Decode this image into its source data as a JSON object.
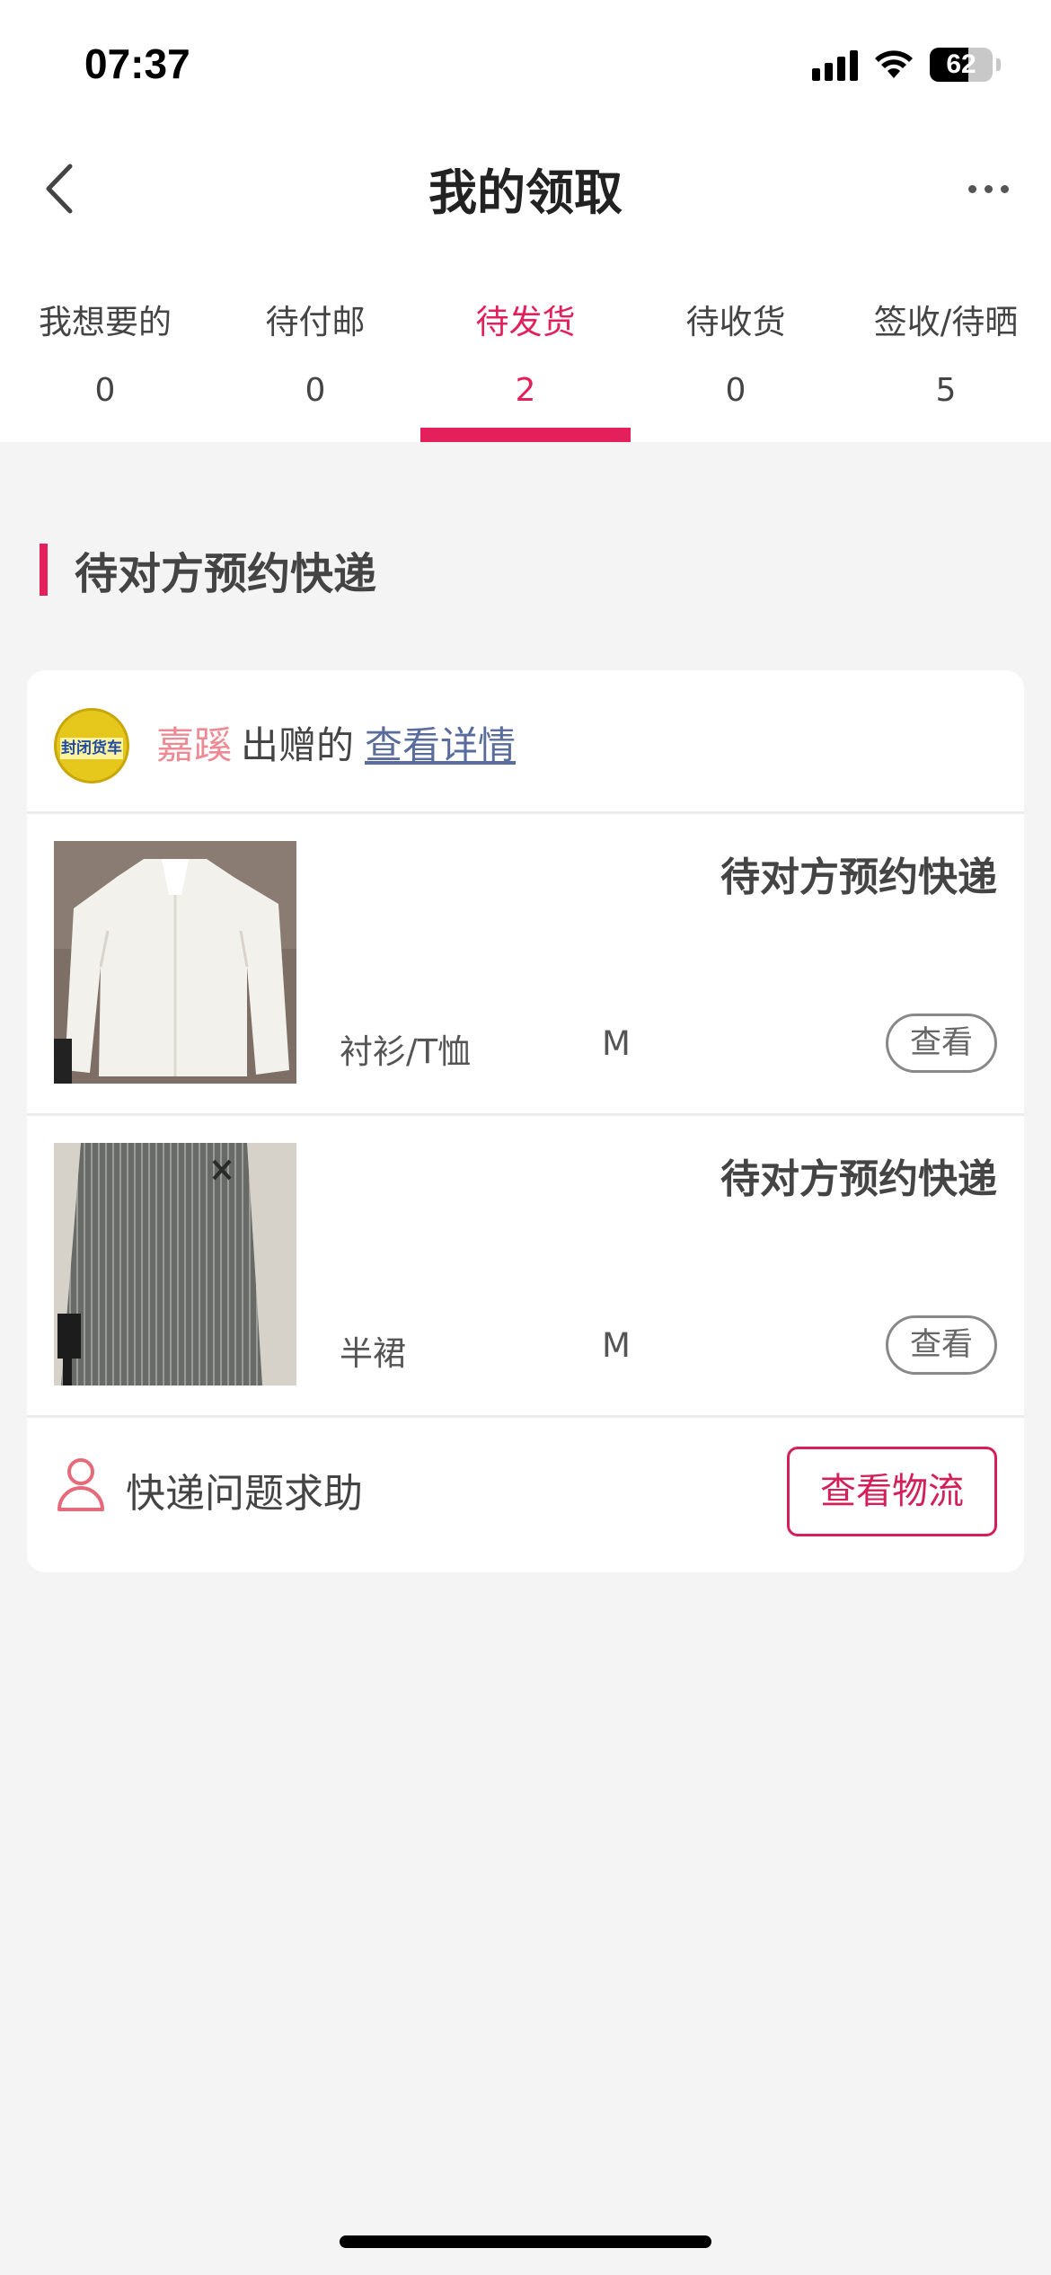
{
  "status_bar": {
    "time": "07:37",
    "battery": "62",
    "battery_level": 0.62
  },
  "header": {
    "title": "我的领取"
  },
  "tabs": [
    {
      "label": "我想要的",
      "count": "0"
    },
    {
      "label": "待付邮",
      "count": "0"
    },
    {
      "label": "待发货",
      "count": "2"
    },
    {
      "label": "待收货",
      "count": "0"
    },
    {
      "label": "签收/待晒",
      "count": "5"
    }
  ],
  "section": {
    "title": "待对方预约快递"
  },
  "card": {
    "avatar_text": "封闭货车",
    "giver_name": "嘉蹊",
    "giver_action": "出赠的",
    "detail_link": "查看详情",
    "items": [
      {
        "status": "待对方预约快递",
        "category": "衬衫/T恤",
        "size": "M",
        "view_label": "查看"
      },
      {
        "status": "待对方预约快递",
        "category": "半裙",
        "size": "M",
        "view_label": "查看"
      }
    ],
    "help_text": "快递问题求助",
    "logistics_label": "查看物流"
  },
  "colors": {
    "accent": "#e3205b",
    "giver_name": "#ee8a93",
    "link": "#5a6c9c"
  }
}
